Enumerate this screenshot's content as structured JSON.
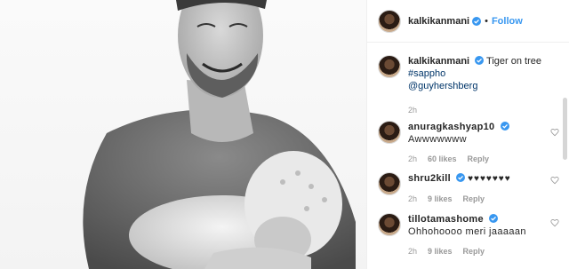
{
  "post": {
    "author": "kalkikanmani",
    "follow_label": "Follow",
    "caption": {
      "username": "kalkikanmani",
      "text": "Tiger on tree",
      "hashtag": "#sappho",
      "mention": "@guyhershberg",
      "time": "2h"
    }
  },
  "comments": [
    {
      "username": "anuragkashyap10",
      "text": "Awwwwwww",
      "time": "2h",
      "likes": "60 likes",
      "reply": "Reply"
    },
    {
      "username": "shru2kill",
      "text": "♥♥♥♥♥♥♥",
      "time": "2h",
      "likes": "9 likes",
      "reply": "Reply"
    },
    {
      "username": "tillotamashome",
      "text": "Ohhohoooo meri jaaaaan",
      "time": "2h",
      "likes": "9 likes",
      "reply": "Reply"
    }
  ],
  "colors": {
    "link": "#3897f0",
    "verified": "#3897f0",
    "meta": "#999999",
    "tag": "#003569"
  },
  "icons": [
    "verified-badge-icon",
    "heart-outline-icon"
  ]
}
